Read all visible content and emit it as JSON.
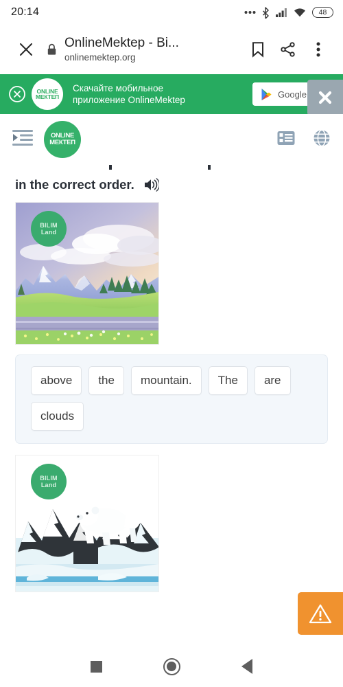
{
  "statusbar": {
    "time": "20:14",
    "battery_level": "48",
    "icons": [
      "more-dots-icon",
      "bluetooth-icon",
      "cellular-signal-icon",
      "wifi-icon",
      "battery-icon"
    ]
  },
  "browser": {
    "close_label": "close-tab",
    "page_title": "OnlineMektep - Bi...",
    "host": "onlinemektep.org",
    "bookmark_label": "bookmark",
    "share_label": "share",
    "menu_label": "more options"
  },
  "promo": {
    "logo_line1": "ONLINE",
    "logo_line2": "МЕКТЕП",
    "text_line1": "Скачайте мобильное",
    "text_line2": "приложение OnlineMektep",
    "store_label": "Google P",
    "banner_color": "#27ab60",
    "close_overlay_label": "close ad"
  },
  "app_toolbar": {
    "menu_icon": "indent-list-icon",
    "logo_line1": "ONLINE",
    "logo_line2": "МЕКТЕП",
    "list_icon": "content-list-icon",
    "globe_icon": "language-globe-icon",
    "icon_color": "#8fa3b5"
  },
  "question": {
    "text": "in the correct order.",
    "audio_icon": "speaker-icon"
  },
  "images": [
    {
      "name": "mountain-landscape",
      "badge_line1": "BILIM",
      "badge_line2": "Land",
      "alt": "Mountain landscape with clouds, green meadow and road"
    },
    {
      "name": "polar-bear-ice",
      "badge_line1": "BILIM",
      "badge_line2": "Land",
      "alt": "Polar bear standing on snowy rocks above icy water"
    }
  ],
  "word_bank": {
    "tiles": [
      "above",
      "the",
      "mountain.",
      "The",
      "are",
      "clouds"
    ],
    "background": "#f3f7fb"
  },
  "report": {
    "label": "report-problem",
    "color": "#f0922f",
    "icon": "warning-triangle-icon"
  },
  "android_nav": {
    "recents_label": "recent-apps",
    "home_label": "home",
    "back_label": "back"
  }
}
